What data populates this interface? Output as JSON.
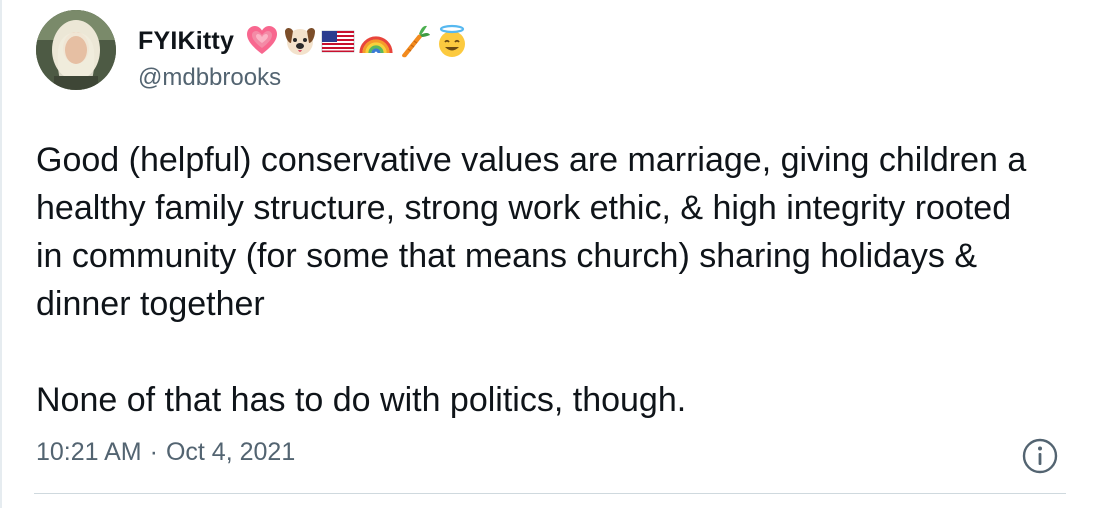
{
  "tweet": {
    "author": {
      "display_name": "FYIKitty",
      "handle": "@mdbbrooks",
      "name_emojis": [
        "pink-heart-icon",
        "dog-face-icon",
        "us-flag-icon",
        "rainbow-icon",
        "carrot-icon",
        "smiling-halo-icon"
      ]
    },
    "text": {
      "paragraph_1": "Good (helpful) conservative values are marriage, giving children a healthy family structure, strong work ethic, & high integrity rooted in community (for some that means church) sharing holidays & dinner together",
      "paragraph_2": "None of that has to do with politics, though."
    },
    "time": "10:21 AM",
    "separator": "·",
    "date": "Oct 4, 2021"
  },
  "colors": {
    "text_primary": "#0f1419",
    "text_secondary": "#536471",
    "divider": "#cfd9de"
  }
}
